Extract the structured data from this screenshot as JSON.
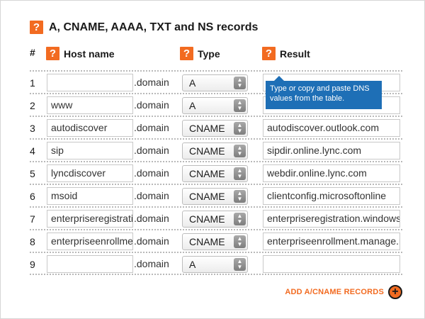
{
  "section": {
    "help_icon": "?",
    "title": "A, CNAME, AAAA, TXT and NS records"
  },
  "columns": {
    "num": "#",
    "host": "Host name",
    "type": "Type",
    "result": "Result",
    "help_icon": "?"
  },
  "rows": [
    {
      "num": "1",
      "host": "",
      "domain": ".domain",
      "type": "A",
      "result": ""
    },
    {
      "num": "2",
      "host": "www",
      "domain": ".domain",
      "type": "A",
      "result": ""
    },
    {
      "num": "3",
      "host": "autodiscover",
      "domain": ".domain",
      "type": "CNAME",
      "result": "autodiscover.outlook.com"
    },
    {
      "num": "4",
      "host": "sip",
      "domain": ".domain",
      "type": "CNAME",
      "result": "sipdir.online.lync.com"
    },
    {
      "num": "5",
      "host": "lyncdiscover",
      "domain": ".domain",
      "type": "CNAME",
      "result": "webdir.online.lync.com"
    },
    {
      "num": "6",
      "host": "msoid",
      "domain": ".domain",
      "type": "CNAME",
      "result": "clientconfig.microsoftonline"
    },
    {
      "num": "7",
      "host": "enterpriseregistration",
      "domain": ".domain",
      "type": "CNAME",
      "result": "enterpriseregistration.windows.net"
    },
    {
      "num": "8",
      "host": "enterpriseenrollment",
      "domain": ".domain",
      "type": "CNAME",
      "result": "enterpriseenrollment.manage.microsoft.com"
    },
    {
      "num": "9",
      "host": "",
      "domain": ".domain",
      "type": "A",
      "result": ""
    }
  ],
  "tooltip": {
    "text": "Type or copy and paste DNS values from the table."
  },
  "add": {
    "label": "ADD A/CNAME RECORDS",
    "icon": "plus-icon"
  },
  "colors": {
    "accent": "#f26b21",
    "tooltip": "#1e6fb6"
  }
}
